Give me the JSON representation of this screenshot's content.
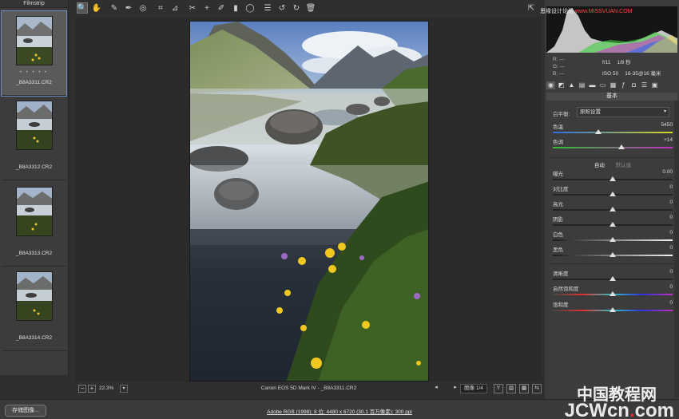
{
  "filmstrip": {
    "title": "Filmstrip",
    "items": [
      {
        "name": "_B8A3311.CR2",
        "rating": "• • • • •",
        "selected": true
      },
      {
        "name": "_B8A3312.CR2",
        "rating": "",
        "selected": false
      },
      {
        "name": "_B8A3313.CR2",
        "rating": "",
        "selected": false
      },
      {
        "name": "_B8A3314.CR2",
        "rating": "",
        "selected": false
      }
    ]
  },
  "toolbar": {
    "tools": [
      {
        "id": "zoom-tool",
        "glyph": "🔍"
      },
      {
        "id": "hand-tool",
        "glyph": "✋"
      },
      {
        "id": "white-balance-tool",
        "glyph": "✎"
      },
      {
        "id": "color-sampler-tool",
        "glyph": "✒"
      },
      {
        "id": "targeted-adjustment-tool",
        "glyph": "◎"
      },
      {
        "id": "crop-tool",
        "glyph": "⌗"
      },
      {
        "id": "straighten-tool",
        "glyph": "⊿"
      },
      {
        "id": "spot-removal-tool",
        "glyph": "✂"
      },
      {
        "id": "red-eye-tool",
        "glyph": "+"
      },
      {
        "id": "adjustment-brush-tool",
        "glyph": "✐"
      },
      {
        "id": "graduated-filter-tool",
        "glyph": "▮"
      },
      {
        "id": "radial-filter-tool",
        "glyph": "◯"
      },
      {
        "id": "preferences-tool",
        "glyph": "☰"
      },
      {
        "id": "rotate-left-tool",
        "glyph": "↺"
      },
      {
        "id": "rotate-right-tool",
        "glyph": "↻"
      },
      {
        "id": "trash-tool",
        "glyph": "🗑"
      }
    ],
    "fullscreen_glyph": "⇱"
  },
  "watermark_top": {
    "text1": "思缘设计论坛 ",
    "text2": "www.MISSVUAN.COM"
  },
  "readout": {
    "r": "R:  ---",
    "g": "G:  ---",
    "b": "B:  ---"
  },
  "exif": {
    "aperture": "f/11",
    "shutter": "1/8 秒",
    "iso": "ISO 50",
    "lens": "16-35@16 毫米"
  },
  "panel": {
    "title": "基本",
    "wb_label": "白平衡:",
    "wb_value": "原照设置",
    "auto": "自动",
    "default": "默认值",
    "sliders": [
      {
        "id": "temperature",
        "label": "色温",
        "value": "5450",
        "pos": 0.38
      },
      {
        "id": "tint",
        "label": "色调",
        "value": "+14",
        "pos": 0.57
      },
      {
        "id": "exposure",
        "label": "曝光",
        "value": "0.00",
        "pos": 0.5
      },
      {
        "id": "contrast",
        "label": "对比度",
        "value": "0",
        "pos": 0.5
      },
      {
        "id": "highlights",
        "label": "高光",
        "value": "0",
        "pos": 0.5
      },
      {
        "id": "shadows",
        "label": "阴影",
        "value": "0",
        "pos": 0.5
      },
      {
        "id": "whites",
        "label": "白色",
        "value": "0",
        "pos": 0.5
      },
      {
        "id": "blacks",
        "label": "黑色",
        "value": "0",
        "pos": 0.5
      },
      {
        "id": "clarity",
        "label": "清晰度",
        "value": "0",
        "pos": 0.5
      },
      {
        "id": "vibrance",
        "label": "自然饱和度",
        "value": "0",
        "pos": 0.5
      },
      {
        "id": "saturation",
        "label": "饱和度",
        "value": "0",
        "pos": 0.5
      }
    ]
  },
  "statusbar": {
    "zoom_minus": "−",
    "zoom_plus": "+",
    "zoom": "22.3%",
    "camera": "Canon EOS 5D Mark IV - _B8A3311.CR2",
    "image_count": "图像 1/4",
    "prev": "◂",
    "next": "▸",
    "view_y": "Y",
    "view_b": "▥",
    "view_c": "▦",
    "view_d": "⇆"
  },
  "bottombar": {
    "save_label": "存储图像...",
    "workflow": "Adobe RGB (1998); 8 位; 4480 x 6720 (30.1 百万像素); 300 ppi",
    "watermark_text": "JCWcn",
    "watermark_dot": ".",
    "watermark_com": "com",
    "watermark_cn": "中国教程网"
  }
}
